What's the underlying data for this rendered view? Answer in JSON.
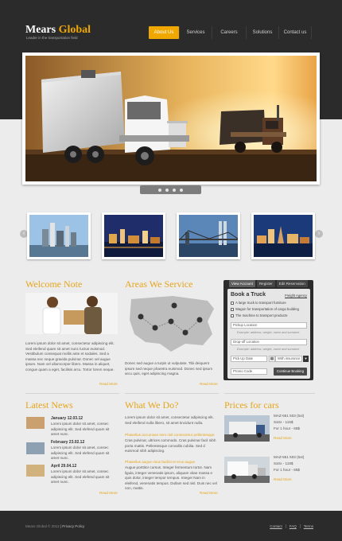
{
  "brand": {
    "name_part1": "Mears",
    "name_part2": "Global",
    "tagline": "Leader in the transportation field"
  },
  "nav": {
    "items": [
      {
        "label": "About Us",
        "active": true
      },
      {
        "label": "Services",
        "active": false
      },
      {
        "label": "Careers",
        "active": false
      },
      {
        "label": "Solutions",
        "active": false
      },
      {
        "label": "Contact us",
        "active": false
      }
    ]
  },
  "slider": {
    "dot_count": 4,
    "active_dot": 0
  },
  "welcome": {
    "title": "Welcome Note",
    "text": "Lorem ipsum dolor sit amet, consectetur adipiscing elit. Sed eleifend quam sit amet nunc luctus euismod. Vestibulum consequat mollis ante et sodales. Sed a massa nec neque gravida pulvinar. Donec vel augue ipsum. Nam vel ullamcorper libero. Massa in aliquet, congue quam a eget, facilisis arcu. Tortor lorem neque.",
    "read_more": "Read More"
  },
  "areas": {
    "title": "Areas We Service",
    "text": "Donec sed augue a turpis ut vulputate. Tibi deiquent ipsum sed neque pharetra euismod. Donec sed ipsum arcu quis, eget adipiscing magna.",
    "read_more": "Read More"
  },
  "booking": {
    "tabs": [
      "View Account",
      "Register",
      "Edit Reservation"
    ],
    "title": "Book a Truck",
    "freight_link": "Freight Agency",
    "options": [
      "A large truck to transport furniture",
      "Wagon for transportation of cargo building",
      "The machine to transport products"
    ],
    "pickup_placeholder": "Pickup Location",
    "pickup_hint": "Example: address, weight, name and surname",
    "dropoff_placeholder": "Drop-off Location",
    "dropoff_hint": "Example: address, weight, name and surname",
    "date_placeholder": "Pick Up Date",
    "insurance_value": "With insurance",
    "promo_placeholder": "Promo Code",
    "continue_label": "Continue Booking"
  },
  "news": {
    "title": "Latest News",
    "items": [
      {
        "date": "January 12.03.12",
        "text": "Lorem ipsum dolor sit amet, consec adipiscing elit. Sed elefend quam sit amet nunc."
      },
      {
        "date": "February 23.02.12",
        "text": "Lorem ipsum dolor sit amet, consec adipiscing elit. Sed elefend quam sit amet nunc."
      },
      {
        "date": "April 29.04.12",
        "text": "Lorem ipsum dolor sit amet, consec adipiscing elit. Sed elefend quam sit amet nunc."
      }
    ],
    "read_more": "Read More"
  },
  "whatwedo": {
    "title": "What We Do?",
    "p1": "Lorem ipsum dolor sit amet, consectetur adipiscing elit. Sed eleifend nulla libero, sit amet tincidunt nulla.",
    "highlight1": "Phasellus accumsan sem nisl consectetur pellentesque",
    "p2": "Cras pulvinar, ultrices commodo. Cras pulvinar facil nibh porta mattis. Pellentesque convallis cubilia. Sed d euismod nibh adipiscing.",
    "highlight2": "Phasellus augue risus facilisi et eros augue",
    "p3": "Augue porttitor cursus. Integer fermentum tortor. Nam ligula, integer venenatis ipsum, aliquam vitae massa e quis dolor, integer tempor tempus. Integer Nam in eleifend, venenatis tempus. Dullam sed nisl. Duis nec vel non, mattis.",
    "read_more": "Read More"
  },
  "prices": {
    "title": "Prices for cars",
    "items": [
      {
        "model": "MAZ-551 503 (5xt)",
        "lines": [
          "Sxtrx - 115$",
          "For 1 hour - 65$"
        ],
        "read_more": "Read More"
      },
      {
        "model": "MAZ-551 503 (5xt)",
        "lines": [
          "Sxtrx - 118$",
          "For 1 hour - 65$"
        ],
        "read_more": "Read More"
      }
    ]
  },
  "footer": {
    "copyright": "Mears Global © 2012",
    "policy": "Privacy Policy",
    "links": [
      "Contact",
      "FAQ",
      "Terms"
    ]
  },
  "colors": {
    "accent": "#f0a800",
    "header_bg": "#2b2b2b",
    "page_bg": "#ececec"
  }
}
